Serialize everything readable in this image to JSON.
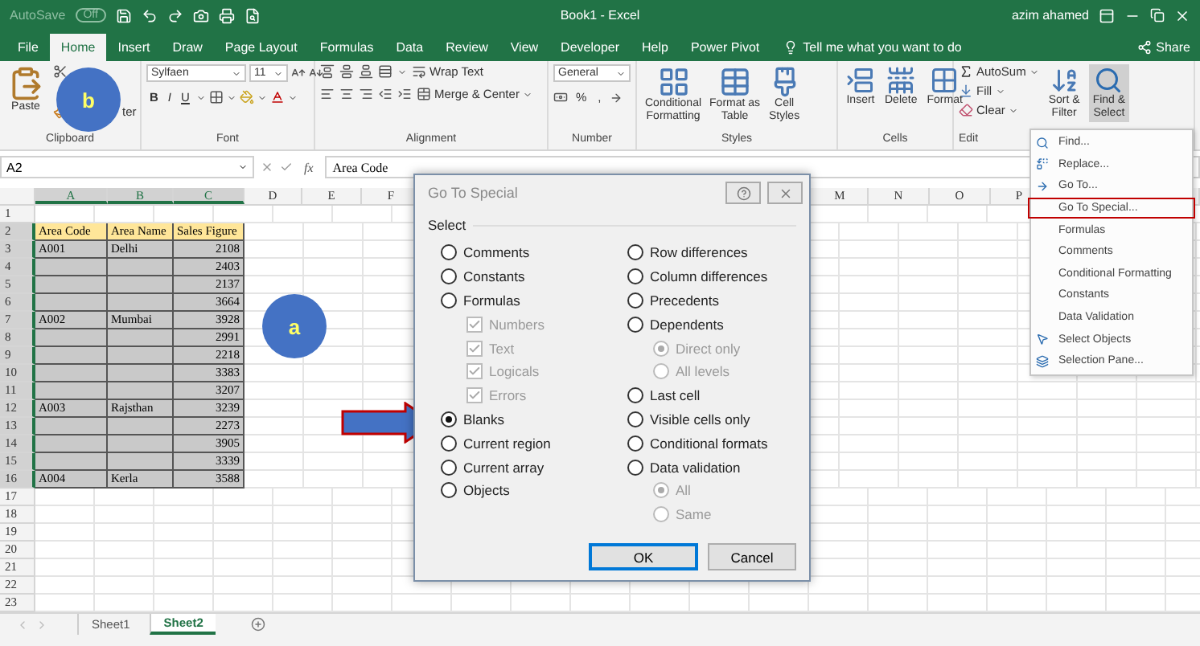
{
  "title_bar": {
    "autosave": "AutoSave",
    "autosave_toggle": "Off",
    "title": "Book1 - Excel",
    "user": "azim ahamed"
  },
  "tabs": [
    {
      "label": "File",
      "selected": false
    },
    {
      "label": "Home",
      "selected": true
    },
    {
      "label": "Insert",
      "selected": false
    },
    {
      "label": "Draw",
      "selected": false
    },
    {
      "label": "Page Layout",
      "selected": false
    },
    {
      "label": "Formulas",
      "selected": false
    },
    {
      "label": "Data",
      "selected": false
    },
    {
      "label": "Review",
      "selected": false
    },
    {
      "label": "View",
      "selected": false
    },
    {
      "label": "Developer",
      "selected": false
    },
    {
      "label": "Help",
      "selected": false
    },
    {
      "label": "Power Pivot",
      "selected": false
    }
  ],
  "tell_me": "Tell me what you want to do",
  "share": "Share",
  "ribbon": {
    "clipboard": {
      "paste": "Paste",
      "format_painter": "ter",
      "label": "Clipboard"
    },
    "font": {
      "name": "Sylfaen",
      "size": "11",
      "bold": "B",
      "italic": "I",
      "underline": "U",
      "label": "Font"
    },
    "alignment": {
      "wrap_text": "Wrap Text",
      "merge_center": "Merge & Center",
      "label": "Alignment"
    },
    "number": {
      "format": "General",
      "percent": "%",
      "comma": ",",
      "label": "Number"
    },
    "styles": {
      "buttons": [
        [
          "Conditional",
          "Formatting"
        ],
        [
          "Format as",
          "Table"
        ],
        [
          "Cell",
          "Styles"
        ]
      ],
      "label": "Styles"
    },
    "cells": {
      "buttons": [
        "Insert",
        "Delete",
        "Format"
      ],
      "label": "Cells"
    },
    "editing": {
      "autosum": "AutoSum",
      "fill": "Fill",
      "clear": "Clear",
      "sort_filter": [
        "Sort &",
        "Filter"
      ],
      "find_select": [
        "Find &",
        "Select"
      ],
      "label": "Edit"
    }
  },
  "formula_bar": {
    "name_box": "A2",
    "function_button": "fx",
    "formula": "Area Code"
  },
  "columns": [
    {
      "label": "A",
      "selected": true
    },
    {
      "label": "B",
      "selected": true
    },
    {
      "label": "C",
      "selected": true
    },
    {
      "label": "D",
      "selected": false
    },
    {
      "label": "E",
      "selected": false
    },
    {
      "label": "F",
      "selected": false
    },
    {
      "label": "M",
      "selected": false
    },
    {
      "label": "N",
      "selected": false
    },
    {
      "label": "O",
      "selected": false
    },
    {
      "label": "P",
      "selected": false
    }
  ],
  "rows": [
    {
      "label": "1",
      "selected": false
    },
    {
      "label": "2",
      "selected": true
    },
    {
      "label": "3",
      "selected": true
    },
    {
      "label": "4",
      "selected": true
    },
    {
      "label": "5",
      "selected": true
    },
    {
      "label": "6",
      "selected": true
    },
    {
      "label": "7",
      "selected": true
    },
    {
      "label": "8",
      "selected": true
    },
    {
      "label": "9",
      "selected": true
    },
    {
      "label": "10",
      "selected": true
    },
    {
      "label": "11",
      "selected": true
    },
    {
      "label": "12",
      "selected": true
    },
    {
      "label": "13",
      "selected": true
    },
    {
      "label": "14",
      "selected": true
    },
    {
      "label": "15",
      "selected": true
    },
    {
      "label": "16",
      "selected": true
    },
    {
      "label": "17",
      "selected": false
    },
    {
      "label": "18",
      "selected": false
    },
    {
      "label": "19",
      "selected": false
    },
    {
      "label": "20",
      "selected": false
    },
    {
      "label": "21",
      "selected": false
    },
    {
      "label": "22",
      "selected": false
    },
    {
      "label": "23",
      "selected": false
    }
  ],
  "table": {
    "header": [
      "Area Code",
      "Area Name",
      "Sales Figure"
    ],
    "rows": [
      {
        "area_code": "A001",
        "area_name": "Delhi",
        "sales_figure": "2108"
      },
      {
        "sales_figure": "2403"
      },
      {
        "sales_figure": "2137"
      },
      {
        "sales_figure": "3664"
      },
      {
        "area_code": "A002",
        "area_name": "Mumbai",
        "sales_figure": "3928"
      },
      {
        "sales_figure": "2991"
      },
      {
        "sales_figure": "2218"
      },
      {
        "sales_figure": "3383"
      },
      {
        "sales_figure": "3207"
      },
      {
        "area_code": "A003",
        "area_name": "Rajsthan",
        "sales_figure": "3239"
      },
      {
        "sales_figure": "2273"
      },
      {
        "sales_figure": "3905"
      },
      {
        "sales_figure": "3339"
      },
      {
        "area_code": "A004",
        "area_name": "Kerla",
        "sales_figure": "3588"
      }
    ]
  },
  "sheet_tabs": [
    {
      "label": "Sheet1",
      "selected": false
    },
    {
      "label": "Sheet2",
      "selected": true
    }
  ],
  "callouts": [
    "b",
    "a"
  ],
  "dialog": {
    "title": "Go To Special",
    "group_label": "Select",
    "left_options": [
      {
        "kind": "radio",
        "label": "Comments",
        "selected": false,
        "disabled": false
      },
      {
        "kind": "radio",
        "label": "Constants",
        "selected": false,
        "disabled": false
      },
      {
        "kind": "radio",
        "label": "Formulas",
        "selected": false,
        "disabled": false,
        "children": [
          {
            "kind": "checkbox",
            "label": "Numbers",
            "checked": true,
            "disabled": true
          },
          {
            "kind": "checkbox",
            "label": "Text",
            "checked": true,
            "disabled": true
          },
          {
            "kind": "checkbox",
            "label": "Logicals",
            "checked": true,
            "disabled": true
          },
          {
            "kind": "checkbox",
            "label": "Errors",
            "checked": true,
            "disabled": true
          }
        ]
      },
      {
        "kind": "radio",
        "label": "Blanks",
        "selected": true,
        "disabled": false
      },
      {
        "kind": "radio",
        "label": "Current region",
        "selected": false,
        "disabled": false
      },
      {
        "kind": "radio",
        "label": "Current array",
        "selected": false,
        "disabled": false
      },
      {
        "kind": "radio",
        "label": "Objects",
        "selected": false,
        "disabled": false
      }
    ],
    "right_options": [
      {
        "kind": "radio",
        "label": "Row differences",
        "selected": false,
        "disabled": false
      },
      {
        "kind": "radio",
        "label": "Column differences",
        "selected": false,
        "disabled": false
      },
      {
        "kind": "radio",
        "label": "Precedents",
        "selected": false,
        "disabled": false
      },
      {
        "kind": "radio",
        "label": "Dependents",
        "selected": false,
        "disabled": false,
        "children": [
          {
            "kind": "radio",
            "label": "Direct only",
            "selected": true,
            "disabled": true
          },
          {
            "kind": "radio",
            "label": "All levels",
            "selected": false,
            "disabled": true
          }
        ]
      },
      {
        "kind": "radio",
        "label": "Last cell",
        "selected": false,
        "disabled": false
      },
      {
        "kind": "radio",
        "label": "Visible cells only",
        "selected": false,
        "disabled": false
      },
      {
        "kind": "radio",
        "label": "Conditional formats",
        "selected": false,
        "disabled": false
      },
      {
        "kind": "radio",
        "label": "Data validation",
        "selected": false,
        "disabled": false,
        "children": [
          {
            "kind": "radio",
            "label": "All",
            "selected": true,
            "disabled": true
          },
          {
            "kind": "radio",
            "label": "Same",
            "selected": false,
            "disabled": true
          }
        ]
      }
    ],
    "buttons": [
      {
        "label": "OK",
        "default": true
      },
      {
        "label": "Cancel",
        "default": false
      }
    ]
  },
  "menu": [
    {
      "label": "Find...",
      "highlighted": false
    },
    {
      "label": "Replace...",
      "highlighted": false
    },
    {
      "label": "Go To...",
      "highlighted": false
    },
    {
      "label": "Go To Special...",
      "highlighted": true
    },
    {
      "label": "Formulas",
      "highlighted": false
    },
    {
      "label": "Comments",
      "highlighted": false
    },
    {
      "label": "Conditional Formatting",
      "highlighted": false
    },
    {
      "label": "Constants",
      "highlighted": false
    },
    {
      "label": "Data Validation",
      "highlighted": false
    },
    {
      "label": "Select Objects",
      "highlighted": false
    },
    {
      "label": "Selection Pane...",
      "highlighted": false
    }
  ]
}
